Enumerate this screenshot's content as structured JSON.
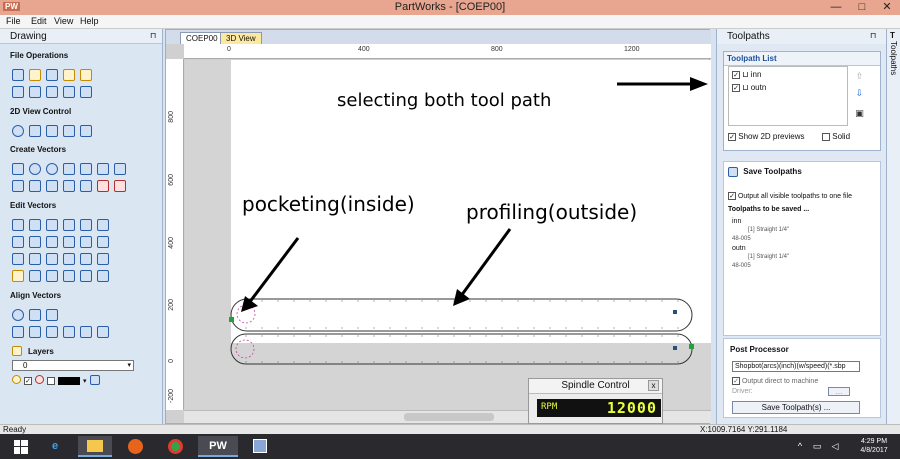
{
  "window": {
    "app_icon": "PW",
    "title": "PartWorks - [COEP00]",
    "minimize_label": "—",
    "maximize_label": "□",
    "close_label": "✕"
  },
  "menu": [
    "File",
    "Edit",
    "View",
    "Help"
  ],
  "drawing_panel": {
    "header": "Drawing",
    "pin": "⊓",
    "sections": {
      "file_operations": "File Operations",
      "view_control": "2D View Control",
      "create_vectors": "Create Vectors",
      "edit_vectors": "Edit Vectors",
      "align_vectors": "Align Vectors",
      "layers": "Layers"
    },
    "layer_value": "0"
  },
  "document": {
    "tabs": [
      "COEP00",
      "3D View"
    ],
    "ruler_top": [
      "0",
      "400",
      "800",
      "1200"
    ],
    "ruler_left": [
      "800",
      "600",
      "400",
      "200",
      "0",
      "-200"
    ]
  },
  "annotations": {
    "selecting": "selecting both tool path",
    "pocketing": "pocketing(inside)",
    "profiling": "profiling(outside)"
  },
  "spindle": {
    "title": "Spindle Control",
    "close": "x",
    "rpm_label": "RPM",
    "rpm_value": "12000"
  },
  "toolpaths_panel": {
    "header": "Toolpaths",
    "pin": "⊓",
    "list_title": "Toolpath List",
    "items": [
      "inn",
      "outn"
    ],
    "show_previews": "Show 2D previews",
    "solid": "Solid",
    "save_title": "Save Toolpaths",
    "output_all": "Output all visible toolpaths to one file",
    "to_be_saved": "Toolpaths to be saved ...",
    "saved": [
      {
        "name": "inn",
        "detail": "[1] Straight 1/4\"",
        "code": "48-005"
      },
      {
        "name": "outn",
        "detail": "[1] Straight 1/4\"",
        "code": "48-005"
      }
    ],
    "post_processor": "Post Processor",
    "post_value": "Shopbot(arcs)(inch)(w/speed)(*.sbp",
    "output_direct": "Output direct to machine",
    "driver": "Driver:",
    "browse": "...",
    "save_button": "Save Toolpath(s) ..."
  },
  "side_tab": "Toolpaths",
  "side_tab_glyph": "T",
  "status": {
    "left": "Ready",
    "coords": "X:1009.7164 Y:291.1184"
  },
  "taskbar": {
    "pw_label": "PW",
    "time": "4:29 PM",
    "date": "4/8/2017"
  }
}
